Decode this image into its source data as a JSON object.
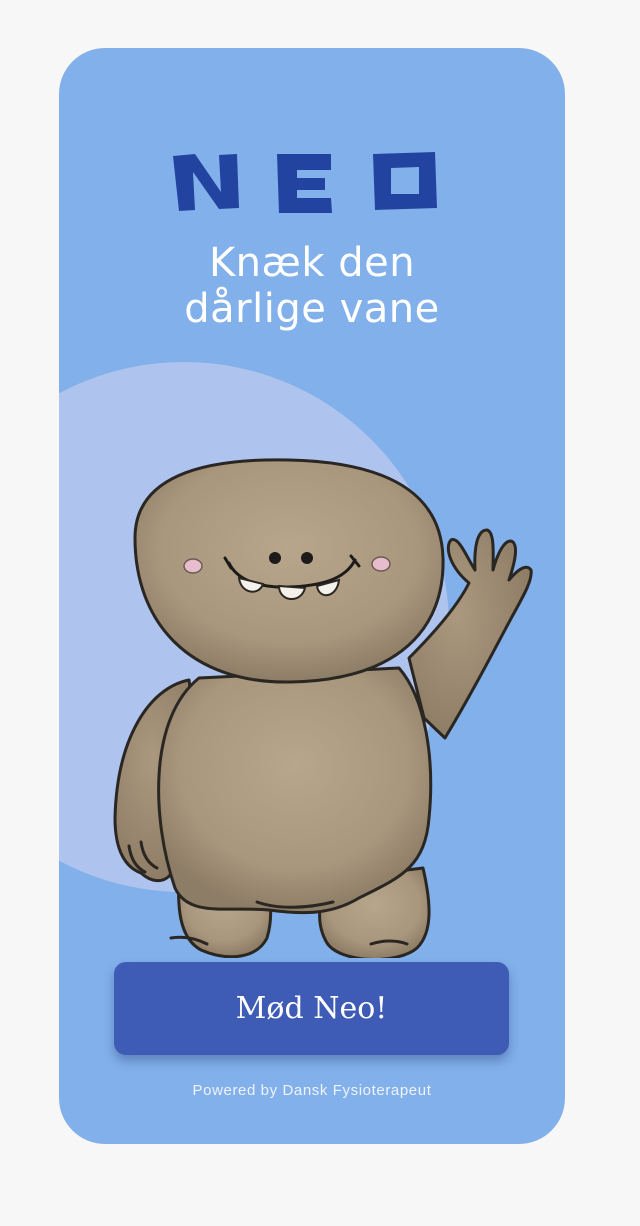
{
  "app": {
    "logo_text": "NEO",
    "headline_line1": "Knæk den",
    "headline_line2": "dårlige vane",
    "cta_label": "Mød Neo!",
    "powered_by": "Powered by Dansk Fysioterapeut"
  },
  "mascot": {
    "icon": "waving-monster-mascot"
  },
  "colors": {
    "page_background": "#f7f7f7",
    "card_background": "#82b0ea",
    "circle": "#aec4ee",
    "logo": "#2343a0",
    "button": "#3e5bb5",
    "text": "#ffffff",
    "mascot_body": "#ae9c84"
  }
}
